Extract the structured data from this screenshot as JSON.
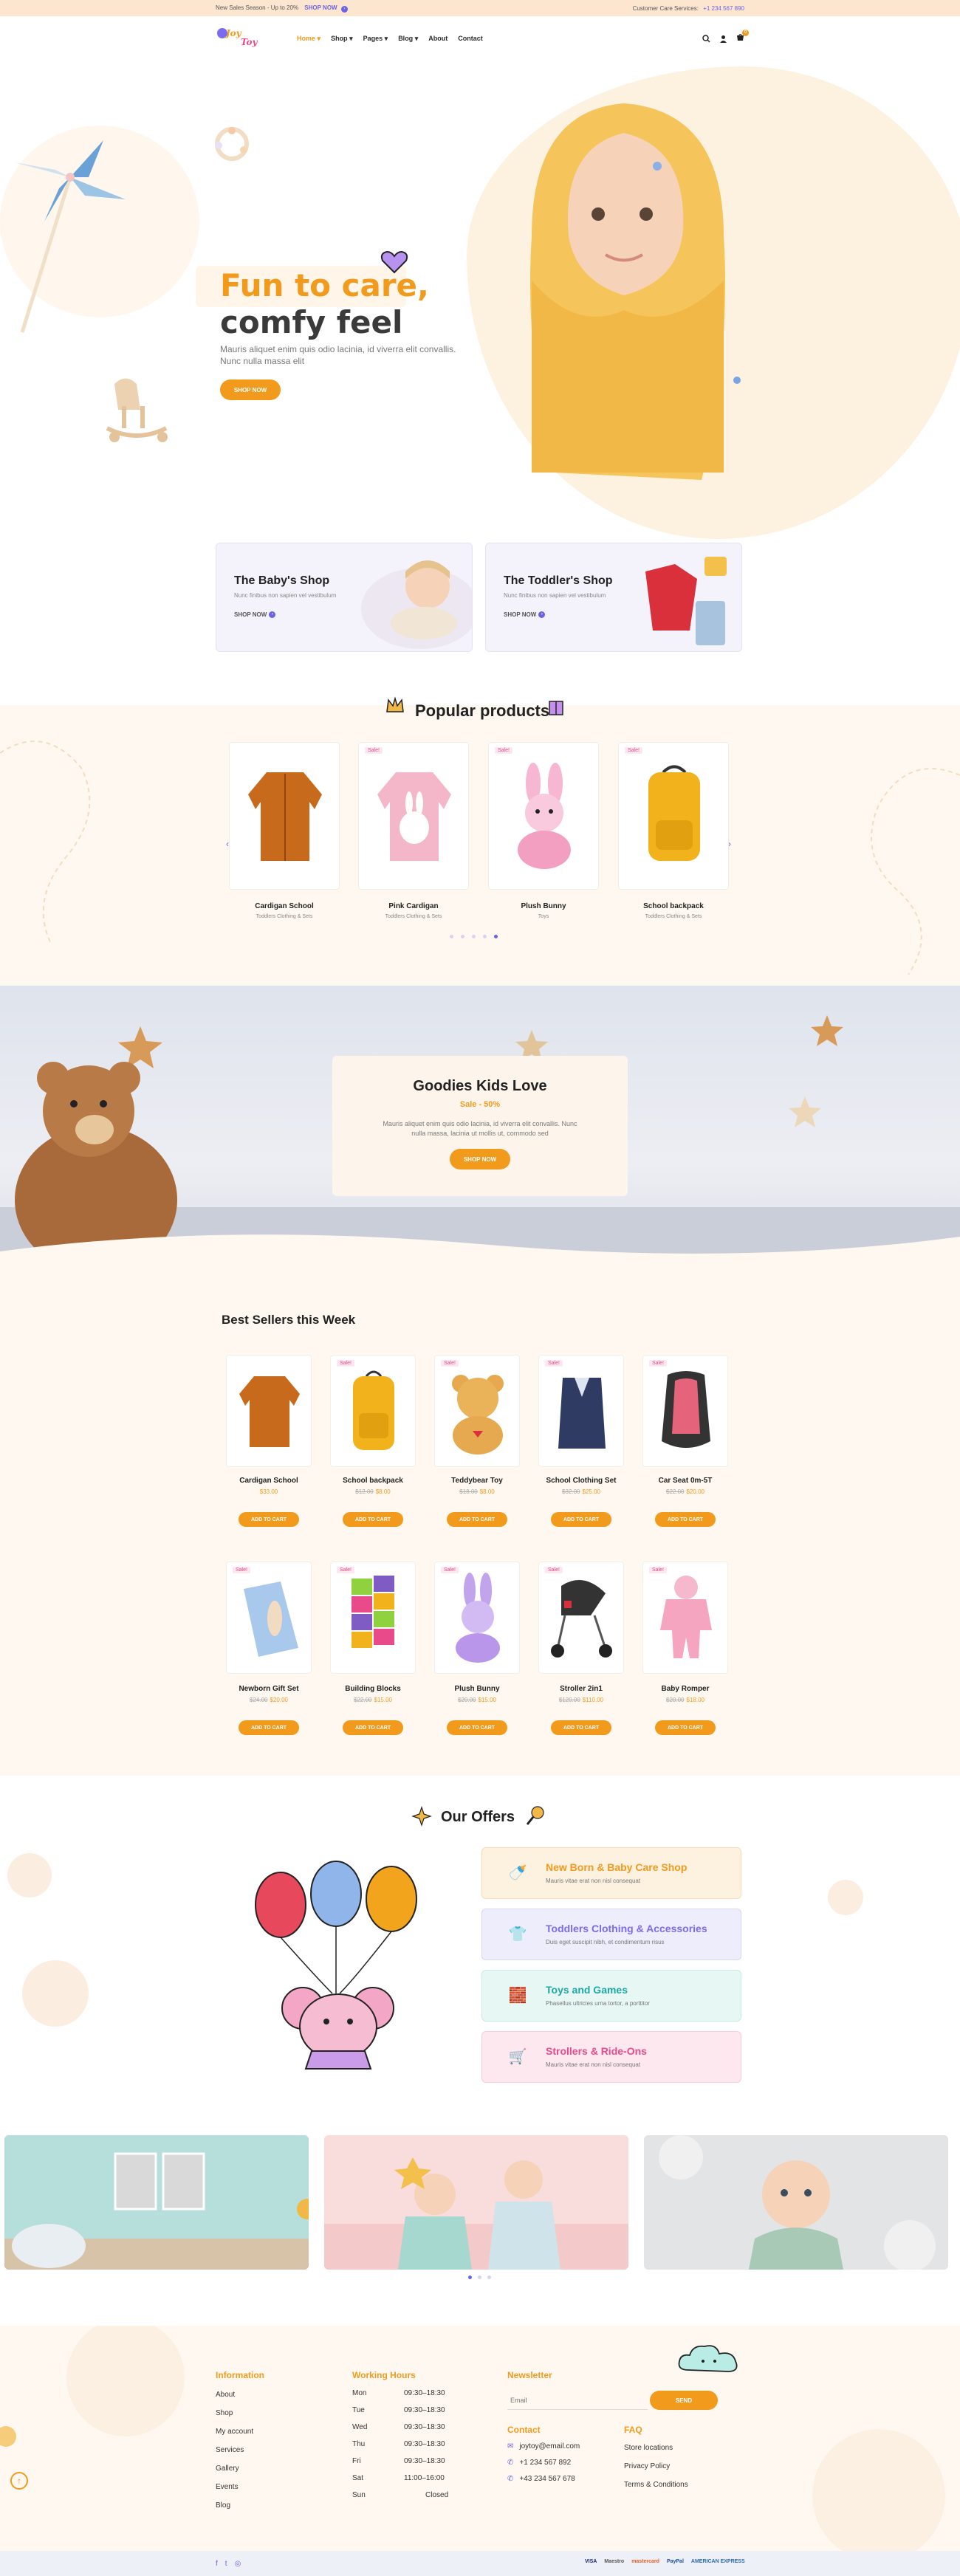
{
  "topbar": {
    "promo": "New Sales Season - Up to 20%",
    "shop_now": "SHOP NOW",
    "support_label": "Customer Care Services:",
    "support_phone": "+1 234 567 890"
  },
  "header": {
    "logo_top": "Joy",
    "logo_bottom": "Toy",
    "nav": [
      {
        "label": "Home",
        "active": true,
        "has_dropdown": true
      },
      {
        "label": "Shop",
        "active": false,
        "has_dropdown": true
      },
      {
        "label": "Pages",
        "active": false,
        "has_dropdown": true
      },
      {
        "label": "Blog",
        "active": false,
        "has_dropdown": true
      },
      {
        "label": "About",
        "active": false,
        "has_dropdown": false
      },
      {
        "label": "Contact",
        "active": false,
        "has_dropdown": false
      }
    ],
    "cart_count": "0"
  },
  "hero": {
    "title_line1": "Fun to care,",
    "title_line2": "comfy feel",
    "text": "Mauris aliquet enim quis odio lacinia, id viverra elit convallis. Nunc nulla massa elit",
    "button": "SHOP NOW"
  },
  "shops": [
    {
      "title": "The Baby's Shop",
      "text": "Nunc finibus non sapien vel vestibulum",
      "link": "SHOP NOW"
    },
    {
      "title": "The Toddler's Shop",
      "text": "Nunc finibus non sapien vel vestibulum",
      "link": "SHOP NOW"
    }
  ],
  "popular": {
    "title": "Popular products",
    "items": [
      {
        "name": "Cardigan School",
        "category": "Toddlers Clothing & Sets",
        "sale": ""
      },
      {
        "name": "Pink Cardigan",
        "category": "Toddlers Clothing & Sets",
        "sale": "Sale!"
      },
      {
        "name": "Plush Bunny",
        "category": "Toys",
        "sale": "Sale!"
      },
      {
        "name": "School backpack",
        "category": "Toddlers Clothing & Sets",
        "sale": "Sale!"
      }
    ]
  },
  "banner": {
    "title": "Goodies Kids Love",
    "subtitle": "Sale - 50%",
    "text": "Mauris aliquet enim quis odio lacinia, id viverra elit convallis. Nunc nulla massa, lacinia ut mollis ut, commodo sed",
    "button": "SHOP NOW"
  },
  "best": {
    "title": "Best Sellers this Week",
    "button": "ADD TO CART",
    "items": [
      {
        "name": "Cardigan School",
        "old": "",
        "price": "$33.00",
        "sale": ""
      },
      {
        "name": "School backpack",
        "old": "$12.00",
        "price": "$8.00",
        "sale": "Sale!"
      },
      {
        "name": "Teddybear Toy",
        "old": "$18.00",
        "price": "$8.00",
        "sale": "Sale!"
      },
      {
        "name": "School Clothing Set",
        "old": "$32.00",
        "price": "$25.00",
        "sale": "Sale!"
      },
      {
        "name": "Car Seat 0m-5T",
        "old": "$22.00",
        "price": "$20.00",
        "sale": "Sale!"
      },
      {
        "name": "Newborn Gift Set",
        "old": "$24.00",
        "price": "$20.00",
        "sale": "Sale!"
      },
      {
        "name": "Building Blocks",
        "old": "$22.00",
        "price": "$15.00",
        "sale": "Sale!"
      },
      {
        "name": "Plush Bunny",
        "old": "$20.00",
        "price": "$15.00",
        "sale": "Sale!"
      },
      {
        "name": "Stroller 2in1",
        "old": "$120.00",
        "price": "$110.00",
        "sale": "Sale!"
      },
      {
        "name": "Baby Romper",
        "old": "$20.00",
        "price": "$18.00",
        "sale": "Sale!"
      }
    ]
  },
  "offers": {
    "title": "Our Offers",
    "items": [
      {
        "title": "New Born & Baby Care Shop",
        "text": "Mauris vitae erat non nisl consequat",
        "color": "#f29a1b",
        "bg": "#fdf1e0",
        "icon": "bottle-icon"
      },
      {
        "title": "Toddlers Clothing & Accessories",
        "text": "Duis eget suscipit nibh, et condimentum risus",
        "color": "#7a6cf0",
        "bg": "#eeedfb",
        "icon": "sweater-icon"
      },
      {
        "title": "Toys and Games",
        "text": "Phasellus ultricies urna tortor, a porttitor",
        "color": "#1fa9a4",
        "bg": "#e7f7f4",
        "icon": "blocks-icon"
      },
      {
        "title": "Strollers & Ride-Ons",
        "text": "Mauris vitae erat non nisl consequat",
        "color": "#e94b8a",
        "bg": "#fde8ef",
        "icon": "stroller-icon"
      }
    ]
  },
  "footer": {
    "information_title": "Information",
    "information": [
      "About",
      "Shop",
      "My account",
      "Services",
      "Gallery",
      "Events",
      "Blog"
    ],
    "hours_title": "Working Hours",
    "hours": [
      {
        "day": "Mon",
        "time": "09:30–18:30"
      },
      {
        "day": "Tue",
        "time": "09:30–18:30"
      },
      {
        "day": "Wed",
        "time": "09:30–18:30"
      },
      {
        "day": "Thu",
        "time": "09:30–18:30"
      },
      {
        "day": "Fri",
        "time": "09:30–18:30"
      },
      {
        "day": "Sat",
        "time": "11:00–16:00"
      },
      {
        "day": "Sun",
        "time": "Closed"
      }
    ],
    "newsletter_title": "Newsletter",
    "email_placeholder": "Email",
    "send": "SEND",
    "contact_title": "Contact",
    "email": "joytoy@email.com",
    "phone1": "+1 234 567 892",
    "phone2": "+43 234 567 678",
    "faq_title": "FAQ",
    "faq": [
      "Store locations",
      "Privacy Policy",
      "Terms & Conditions"
    ],
    "payments": [
      "VISA",
      "Maestro",
      "mastercard",
      "PayPal",
      "AMERICAN EXPRESS"
    ]
  }
}
